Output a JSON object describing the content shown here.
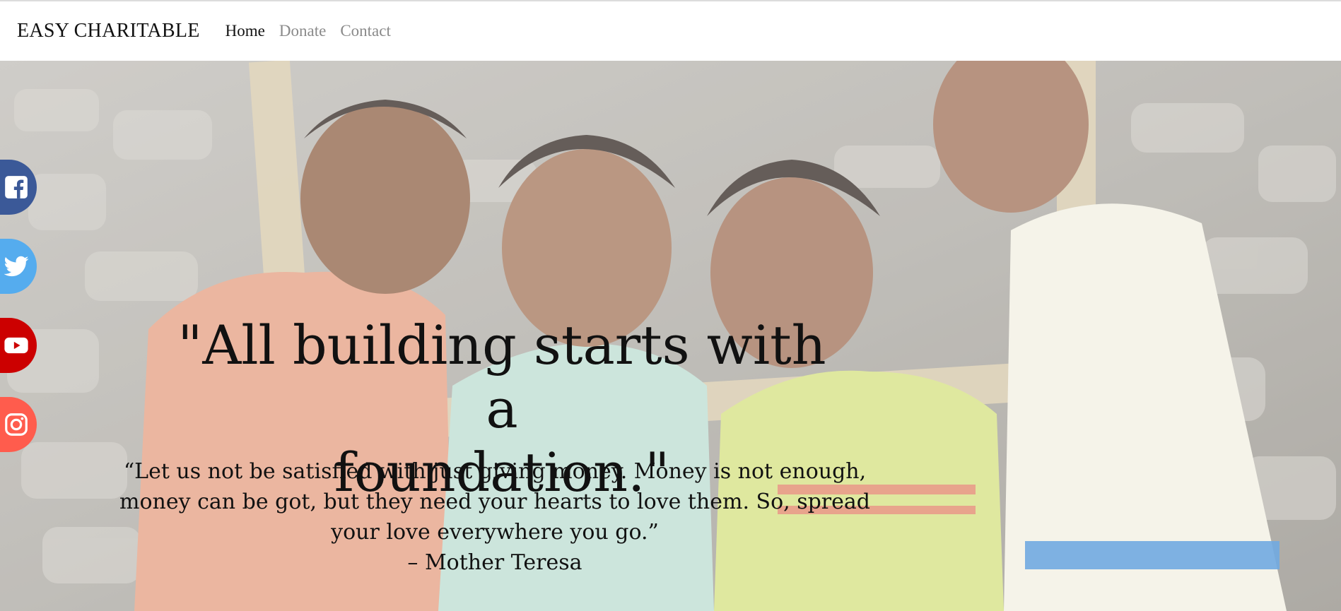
{
  "navbar": {
    "brand": "EASY CHARITABLE",
    "links": [
      {
        "label": "Home",
        "active": true
      },
      {
        "label": "Donate",
        "active": false
      },
      {
        "label": "Contact",
        "active": false
      }
    ]
  },
  "social": [
    {
      "name": "facebook",
      "icon": "facebook-icon",
      "color": "#3b5998"
    },
    {
      "name": "twitter",
      "icon": "twitter-icon",
      "color": "#55acee"
    },
    {
      "name": "youtube",
      "icon": "youtube-icon",
      "color": "#cc0000"
    },
    {
      "name": "instagram",
      "icon": "instagram-icon",
      "color": "#ff5c4d"
    }
  ],
  "hero": {
    "headline_line1": "\"All building starts with a",
    "headline_line2": "foundation.\"",
    "quote_line1": "“Let us not be satisfied with just giving money. Money is not enough,",
    "quote_line2": "money can be got, but they need your hearts to love them. So, spread",
    "quote_line3": "your love everywhere you go.”",
    "attribution": "– Mother Teresa"
  }
}
